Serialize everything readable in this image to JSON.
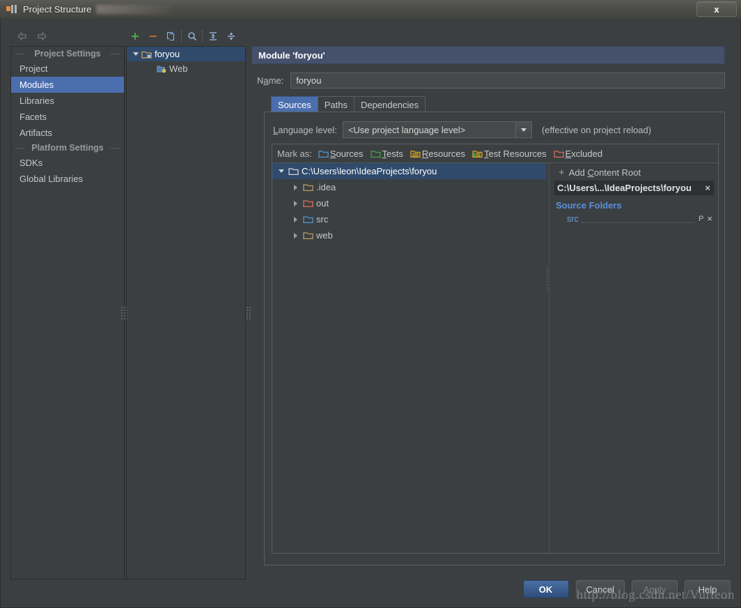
{
  "window": {
    "title": "Project Structure",
    "close_label": "x",
    "app_icon": "intellij-idea-icon"
  },
  "nav_toolbar": {
    "back_icon": "arrow-left-icon",
    "forward_icon": "arrow-right-icon"
  },
  "sidebar": {
    "groups": [
      {
        "label": "Project Settings",
        "items": [
          {
            "label": "Project",
            "selected": false
          },
          {
            "label": "Modules",
            "selected": true
          },
          {
            "label": "Libraries",
            "selected": false
          },
          {
            "label": "Facets",
            "selected": false
          },
          {
            "label": "Artifacts",
            "selected": false
          }
        ]
      },
      {
        "label": "Platform Settings",
        "items": [
          {
            "label": "SDKs",
            "selected": false
          },
          {
            "label": "Global Libraries",
            "selected": false
          }
        ]
      }
    ]
  },
  "module_toolbar": {
    "buttons": [
      {
        "name": "add-button",
        "glyph": "+",
        "color": "#49a849"
      },
      {
        "name": "remove-button",
        "glyph": "–",
        "color": "#c2643f"
      },
      {
        "name": "copy-button",
        "glyph": "copy-icon",
        "color": "#7a9cc6"
      },
      {
        "name": "find-button",
        "glyph": "search-icon",
        "color": "#8ab4e8"
      },
      {
        "name": "expand-all-button",
        "glyph": "expand-all-icon",
        "color": "#8ab4e8"
      },
      {
        "name": "collapse-all-button",
        "glyph": "collapse-all-icon",
        "color": "#8ab4e8"
      }
    ]
  },
  "module_tree": {
    "nodes": [
      {
        "label": "foryou",
        "icon": "module-folder-icon",
        "expanded": true,
        "selected": true,
        "depth": 0
      },
      {
        "label": "Web",
        "icon": "web-facet-icon",
        "expanded": false,
        "selected": false,
        "depth": 1
      }
    ]
  },
  "detail": {
    "header": "Module 'foryou'",
    "name_label_pre": "N",
    "name_label_accel": "a",
    "name_label_post": "me:",
    "name_value": "foryou",
    "name_placeholder": "",
    "tabs": [
      {
        "label": "Sources",
        "active": true
      },
      {
        "label": "Paths",
        "active": false
      },
      {
        "label": "Dependencies",
        "active": false
      }
    ],
    "language_level": {
      "label_pre": "",
      "label_accel": "L",
      "label_post": "anguage level:",
      "value": "<Use project language level>",
      "note": "(effective on project reload)",
      "options": [
        "<Use project language level>"
      ]
    },
    "mark_as": {
      "label": "Mark as:",
      "options": [
        {
          "label": "Sources",
          "accel": "S",
          "rest": "ources",
          "icon": "folder-sources-icon",
          "color": "#4d90c4"
        },
        {
          "label": "Tests",
          "accel": "T",
          "rest": "ests",
          "icon": "folder-tests-icon",
          "color": "#3f9e52"
        },
        {
          "label": "Resources",
          "accel": "R",
          "rest": "esources",
          "icon": "folder-resources-icon",
          "color": "#c9a227"
        },
        {
          "label": "Test Resources",
          "accel": "T",
          "rest": "est Resources",
          "icon": "folder-test-resources-icon",
          "color": "#c9a227"
        },
        {
          "label": "Excluded",
          "accel": "E",
          "rest": "xcluded",
          "icon": "folder-excluded-icon",
          "color": "#cf6a5b"
        }
      ]
    },
    "content_tree": {
      "nodes": [
        {
          "label": "C:\\Users\\leon\\IdeaProjects\\foryou",
          "icon": "folder-icon",
          "color": "#c8c8c8",
          "expanded": true,
          "selected": true,
          "depth": 0
        },
        {
          "label": ".idea",
          "icon": "folder-icon",
          "color": "#b0965f",
          "expanded": false,
          "selected": false,
          "depth": 1
        },
        {
          "label": "out",
          "icon": "folder-excluded-icon",
          "color": "#cf6a5b",
          "expanded": false,
          "selected": false,
          "depth": 1
        },
        {
          "label": "src",
          "icon": "folder-sources-icon",
          "color": "#4d90c4",
          "expanded": false,
          "selected": false,
          "depth": 1
        },
        {
          "label": "web",
          "icon": "folder-icon",
          "color": "#b0965f",
          "expanded": false,
          "selected": false,
          "depth": 1
        }
      ]
    },
    "context_panel": {
      "add_content_root": {
        "plus": "+",
        "pre": "Add ",
        "accel": "C",
        "post": "ontent Root"
      },
      "content_root_chip": {
        "path": "C:\\Users\\...\\IdeaProjects\\foryou",
        "remove": "×"
      },
      "source_folders_title": "Source Folders",
      "source_folders": [
        {
          "name": "src",
          "package_prefix_icon": "package-prefix-icon",
          "remove": "×"
        }
      ]
    }
  },
  "buttons": {
    "ok": "OK",
    "cancel": "Cancel",
    "apply": "Apply",
    "help": "Help"
  },
  "watermark": "http://blog.csdn.net/Vurteon"
}
